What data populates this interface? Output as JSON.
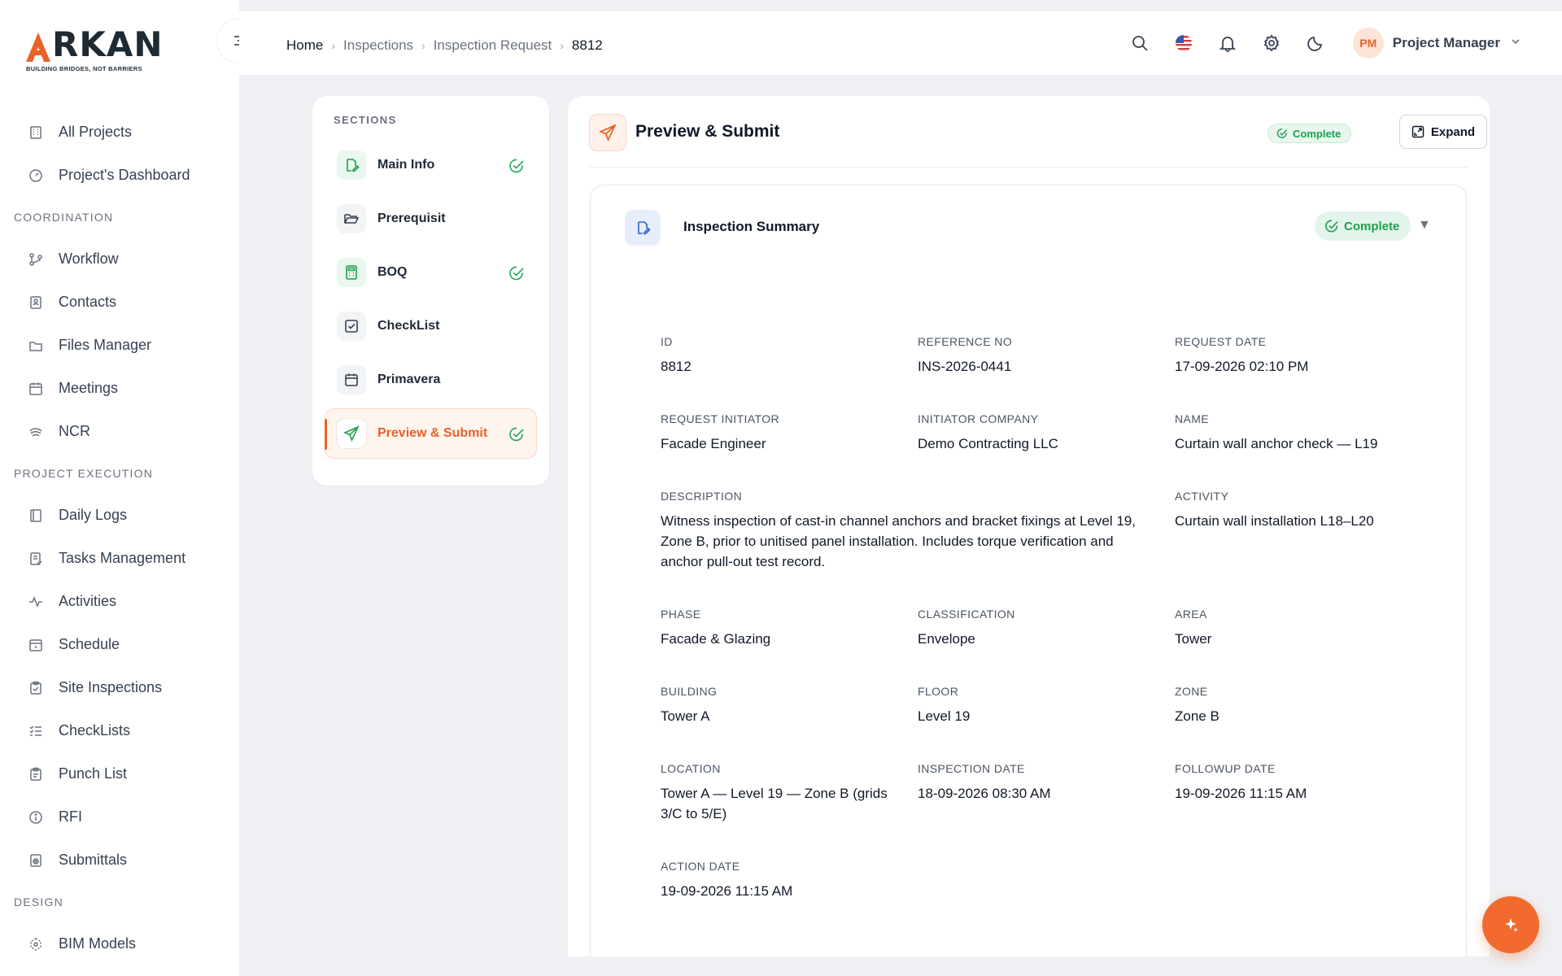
{
  "brand": {
    "name": "RKAN",
    "tagline": "BUILDING BRIDGES, NOT BARRIERS"
  },
  "sidebar": {
    "top": [
      {
        "label": "All Projects",
        "icon": "building-icon"
      },
      {
        "label": "Project's Dashboard",
        "icon": "gauge-icon"
      }
    ],
    "coordination_title": "COORDINATION",
    "coordination": [
      {
        "label": "Workflow",
        "icon": "workflow-icon"
      },
      {
        "label": "Contacts",
        "icon": "contacts-icon"
      },
      {
        "label": "Files Manager",
        "icon": "folder-icon"
      },
      {
        "label": "Meetings",
        "icon": "calendar-icon"
      },
      {
        "label": "NCR",
        "icon": "ncr-icon"
      }
    ],
    "execution_title": "PROJECT EXECUTION",
    "execution": [
      {
        "label": "Daily Logs",
        "icon": "book-icon"
      },
      {
        "label": "Tasks Management",
        "icon": "task-icon"
      },
      {
        "label": "Activities",
        "icon": "pulse-icon"
      },
      {
        "label": "Schedule",
        "icon": "schedule-icon"
      },
      {
        "label": "Site Inspections",
        "icon": "clipboard-icon"
      },
      {
        "label": "CheckLists",
        "icon": "list-check-icon"
      },
      {
        "label": "Punch List",
        "icon": "punch-icon"
      },
      {
        "label": "RFI",
        "icon": "info-icon"
      },
      {
        "label": "Submittals",
        "icon": "submittal-icon"
      }
    ],
    "design_title": "DESIGN",
    "design": [
      {
        "label": "BIM Models",
        "icon": "cube-icon"
      }
    ]
  },
  "breadcrumb": {
    "home": "Home",
    "inspections": "Inspections",
    "request": "Inspection Request",
    "current": "8812"
  },
  "user": {
    "initials": "PM",
    "name": "Project Manager"
  },
  "sections": {
    "title": "SECTIONS",
    "items": [
      {
        "label": "Main Info",
        "complete": true
      },
      {
        "label": "Prerequisit",
        "complete": false
      },
      {
        "label": "BOQ",
        "complete": true
      },
      {
        "label": "CheckList",
        "complete": false
      },
      {
        "label": "Primavera",
        "complete": false
      },
      {
        "label": "Preview & Submit",
        "complete": true,
        "active": true
      }
    ]
  },
  "main": {
    "title": "Preview & Submit",
    "status": "Complete",
    "expand_label": "Expand",
    "summary": {
      "title": "Inspection Summary",
      "status": "Complete",
      "fields": {
        "id": {
          "label": "ID",
          "value": "8812"
        },
        "reference_no": {
          "label": "REFERENCE NO",
          "value": "INS-2026-0441"
        },
        "request_date": {
          "label": "REQUEST DATE",
          "value": "17-09-2026 02:10 PM"
        },
        "request_initiator": {
          "label": "REQUEST INITIATOR",
          "value": "Facade Engineer"
        },
        "initiator_company": {
          "label": "INITIATOR COMPANY",
          "value": "Demo Contracting LLC"
        },
        "name": {
          "label": "NAME",
          "value": "Curtain wall anchor check — L19"
        },
        "description": {
          "label": "DESCRIPTION",
          "value": "Witness inspection of cast-in channel anchors and bracket fixings at Level 19, Zone B, prior to unitised panel installation. Includes torque verification and anchor pull-out test record."
        },
        "activity": {
          "label": "ACTIVITY",
          "value": "Curtain wall installation L18–L20"
        },
        "phase": {
          "label": "PHASE",
          "value": "Facade & Glazing"
        },
        "classification": {
          "label": "CLASSIFICATION",
          "value": "Envelope"
        },
        "area": {
          "label": "AREA",
          "value": "Tower"
        },
        "building": {
          "label": "BUILDING",
          "value": "Tower A"
        },
        "floor": {
          "label": "FLOOR",
          "value": "Level 19"
        },
        "zone": {
          "label": "ZONE",
          "value": "Zone B"
        },
        "location": {
          "label": "LOCATION",
          "value": "Tower A — Level 19 — Zone B (grids 3/C to 5/E)"
        },
        "inspection_date": {
          "label": "INSPECTION DATE",
          "value": "18-09-2026 08:30 AM"
        },
        "followup_date": {
          "label": "FOLLOWUP DATE",
          "value": "19-09-2026 11:15 AM"
        },
        "action_date": {
          "label": "ACTION DATE",
          "value": "19-09-2026 11:15 AM"
        }
      }
    }
  },
  "colors": {
    "accent": "#e8622a",
    "success": "#1f9e4f",
    "background": "#eef0f3"
  }
}
